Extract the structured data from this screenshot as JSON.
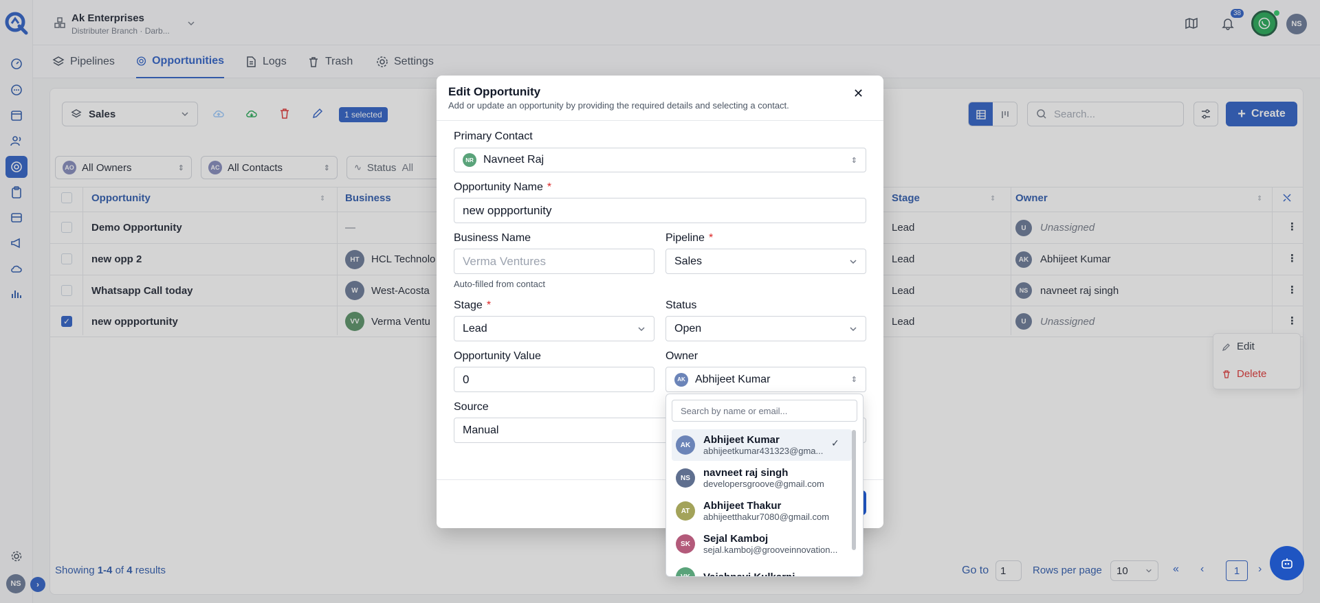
{
  "org": {
    "name": "Ak Enterprises",
    "sub": "Distributer Branch · Darb..."
  },
  "header": {
    "notif_count": "38",
    "user_initials": "NS"
  },
  "tabs": [
    {
      "label": "Pipelines"
    },
    {
      "label": "Opportunities"
    },
    {
      "label": "Logs"
    },
    {
      "label": "Trash"
    },
    {
      "label": "Settings"
    }
  ],
  "toolbar": {
    "pipeline": "Sales",
    "selected": "1 selected",
    "search_placeholder": "Search...",
    "create": "Create"
  },
  "filters": {
    "owners": "All Owners",
    "owners_badge": "AO",
    "contacts": "All Contacts",
    "contacts_badge": "AC",
    "status_label": "Status",
    "status_value": "All"
  },
  "table": {
    "headers": {
      "opportunity": "Opportunity",
      "business": "Business",
      "stage": "Stage",
      "owner": "Owner"
    },
    "rows": [
      {
        "name": "Demo Opportunity",
        "biz_initials": "",
        "business": "—",
        "stage": "Lead",
        "owner_initials": "U",
        "owner": "Unassigned"
      },
      {
        "name": "new opp 2",
        "biz_initials": "HT",
        "business": "HCL Technolo",
        "stage": "Lead",
        "owner_initials": "AK",
        "owner": "Abhijeet Kumar"
      },
      {
        "name": "Whatsapp Call today",
        "biz_initials": "W",
        "business": "West-Acosta",
        "stage": "Lead",
        "owner_initials": "NS",
        "owner": "navneet raj singh"
      },
      {
        "name": "new oppportunity",
        "biz_initials": "VV",
        "business": "Verma Ventu",
        "stage": "Lead",
        "owner_initials": "U",
        "owner": "Unassigned"
      }
    ]
  },
  "context_menu": {
    "edit": "Edit",
    "delete": "Delete"
  },
  "footer": {
    "showing_prefix": "Showing ",
    "range": "1-4",
    "of": " of ",
    "total": "4",
    "results": " results",
    "goto_label": "Go to",
    "goto_value": "1",
    "rows_label": "Rows per page",
    "rows_value": "10",
    "page": "1"
  },
  "sidebar": {
    "user_initials": "NS"
  },
  "modal": {
    "title": "Edit Opportunity",
    "subtitle": "Add or update an opportunity by providing the required details and selecting a contact.",
    "primary_contact_label": "Primary Contact",
    "primary_contact_initials": "NR",
    "primary_contact": "Navneet Raj",
    "opp_name_label": "Opportunity Name",
    "opp_name": "new oppportunity",
    "business_label": "Business Name",
    "business_placeholder": "Verma Ventures",
    "business_hint": "Auto-filled from contact",
    "pipeline_label": "Pipeline",
    "pipeline": "Sales",
    "stage_label": "Stage",
    "stage": "Lead",
    "status_label": "Status",
    "status": "Open",
    "value_label": "Opportunity Value",
    "value": "0",
    "owner_label": "Owner",
    "owner_initials": "AK",
    "owner": "Abhijeet Kumar",
    "source_label": "Source",
    "source": "Manual",
    "required_mark": "*"
  },
  "owner_dropdown": {
    "search_placeholder": "Search by name or email...",
    "items": [
      {
        "initials": "AK",
        "name": "Abhijeet Kumar",
        "email": "abhijeetkumar431323@gma...",
        "color": "#6b84b8"
      },
      {
        "initials": "NS",
        "name": "navneet raj singh",
        "email": "developersgroove@gmail.com",
        "color": "#5f6f8f"
      },
      {
        "initials": "AT",
        "name": "Abhijeet Thakur",
        "email": "abhijeetthakur7080@gmail.com",
        "color": "#a3a35a"
      },
      {
        "initials": "SK",
        "name": "Sejal Kamboj",
        "email": "sejal.kamboj@grooveinnovation...",
        "color": "#b35a7a"
      },
      {
        "initials": "VK",
        "name": "Vaishnavi Kulkarni",
        "email": "",
        "color": "#5aa37a"
      }
    ]
  }
}
